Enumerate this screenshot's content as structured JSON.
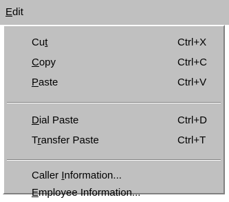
{
  "menu_bar": {
    "title_mnemonic": "E",
    "title_rest": "dit"
  },
  "menu": {
    "items": [
      {
        "pre": "Cu",
        "mnemonic": "t",
        "post": "",
        "shortcut": "Ctrl+X"
      },
      {
        "pre": "",
        "mnemonic": "C",
        "post": "opy",
        "shortcut": "Ctrl+C"
      },
      {
        "pre": "",
        "mnemonic": "P",
        "post": "aste",
        "shortcut": "Ctrl+V"
      },
      {
        "pre": "",
        "mnemonic": "D",
        "post": "ial Paste",
        "shortcut": "Ctrl+D"
      },
      {
        "pre": "T",
        "mnemonic": "r",
        "post": "ansfer Paste",
        "shortcut": "Ctrl+T"
      },
      {
        "pre": "Caller ",
        "mnemonic": "I",
        "post": "nformation...",
        "shortcut": ""
      },
      {
        "pre": "",
        "mnemonic": "E",
        "post": "mployee Information...",
        "shortcut": ""
      }
    ]
  },
  "colors": {
    "menu_background": "#c0c0c0",
    "text": "#000000",
    "bevel_light": "#ffffff",
    "bevel_dark": "#808080"
  }
}
